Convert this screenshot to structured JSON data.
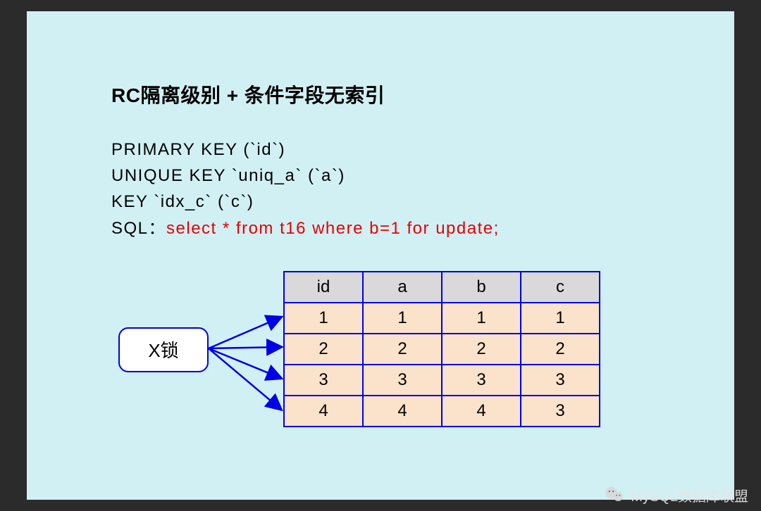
{
  "title": "RC隔离级别 + 条件字段无索引",
  "keys": {
    "pk": "PRIMARY KEY (`id`)",
    "uk": "UNIQUE KEY `uniq_a` (`a`)",
    "idx": "KEY `idx_c` (`c`)",
    "sql_label": "SQL：",
    "sql_stmt": "select * from t16 where b=1 for update;"
  },
  "lock_label": "X锁",
  "chart_data": {
    "type": "table",
    "title": "",
    "columns": [
      "id",
      "a",
      "b",
      "c"
    ],
    "rows": [
      [
        1,
        1,
        1,
        1
      ],
      [
        2,
        2,
        2,
        2
      ],
      [
        3,
        3,
        3,
        3
      ],
      [
        4,
        4,
        4,
        3
      ]
    ]
  },
  "watermark": "MySQL数据库联盟"
}
